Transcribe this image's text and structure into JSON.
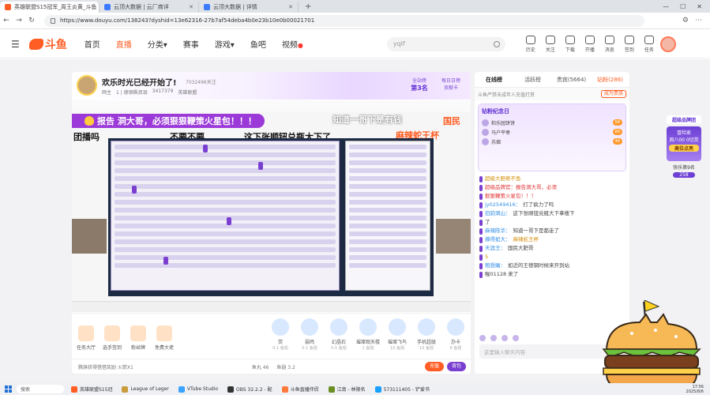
{
  "browser": {
    "tabs": [
      {
        "title": "英雄联盟S15冠军_周王炎黄_斗鱼",
        "active": true
      },
      {
        "title": "云顶大数据 | 云厂商详",
        "active": false
      },
      {
        "title": "云顶大数据 | 详情",
        "active": false
      }
    ],
    "url": "https://www.douyu.com/138243?dyshid=13e62316-27b7af54deba4b0e23b10e0b00021701"
  },
  "site": {
    "logo": "斗鱼",
    "nav": [
      {
        "label": "首页"
      },
      {
        "label": "直播"
      },
      {
        "label": "分类"
      },
      {
        "label": "赛事"
      },
      {
        "label": "游戏"
      },
      {
        "label": "鱼吧"
      },
      {
        "label": "视频"
      }
    ],
    "search_placeholder": "yqlf",
    "tools": [
      {
        "label": "历史"
      },
      {
        "label": "关注"
      },
      {
        "label": "下载"
      },
      {
        "label": "开播"
      },
      {
        "label": "消息"
      },
      {
        "label": "签到"
      },
      {
        "label": "任务"
      }
    ]
  },
  "room": {
    "title": "欢乐时光已经开始了!",
    "room_id": "7032496关注",
    "meta": [
      "网主",
      "1 | 德钢枫叔溺",
      "3417379",
      "英雄联盟"
    ],
    "rank_label": "全站榜",
    "rank_value": "第3名",
    "rank2_label": "每日日榜",
    "rank2_value": "贡献卡"
  },
  "video": {
    "banner": "报告 洞大哥，必须狠狠鞭策火星包！！！",
    "overlay_1": "团播吗",
    "overlay_2": "不要不要",
    "overlay_3": "这下张顺钮兑瓶大下了",
    "overlay_4": "知道一哥下是有钱",
    "overlay_5": "麻辣蛇王杯",
    "overlay_6": "国民"
  },
  "gifts_left": [
    {
      "label": "任务大厅"
    },
    {
      "label": "选手签到"
    },
    {
      "label": "粉丝牌"
    },
    {
      "label": "免费大佬"
    }
  ],
  "gifts_right": [
    {
      "label": "荧",
      "price": "0.1 鱼翅"
    },
    {
      "label": "弱鸡",
      "price": "0.1 鱼翅"
    },
    {
      "label": "幻晶石",
      "price": "0.5 鱼翅"
    },
    {
      "label": "璀璨观天楼",
      "price": "1 鱼翅"
    },
    {
      "label": "璀璨飞鸟",
      "price": "10 鱼翅"
    },
    {
      "label": "手机超级",
      "price": "10 鱼翅"
    },
    {
      "label": "办卡",
      "price": "6 鱼翅"
    }
  ],
  "bottom": {
    "notice": "腾旗获得借借奖励 火箭X1",
    "stats": "鱼丸 46",
    "fish": "鱼翅 3.2",
    "btn_charge": "充值",
    "btn_bag": "背包"
  },
  "chat": {
    "tabs": [
      {
        "label": "在线榜"
      },
      {
        "label": "活跃榜"
      },
      {
        "label": "贵宾(5664)"
      },
      {
        "label": "钻粉(286)"
      }
    ],
    "notice": "斗鱼严禁未成年人充值打赏",
    "notice_btn": "成为贵族",
    "fanbox_title": "钻粉纪念日",
    "fans": [
      {
        "name": "和乐园饼饼",
        "level": "54"
      },
      {
        "name": "马户平枣",
        "level": "60"
      },
      {
        "name": "苏烟",
        "level": "44"
      }
    ],
    "messages": [
      {
        "user": "",
        "text": "超级大胆奇不鱼",
        "cls": "gold"
      },
      {
        "user": "",
        "text": "超级品牌官：报告洞大哥，必须",
        "cls": "red"
      },
      {
        "user": "",
        "text": "狠狠鞭策火星包！！！",
        "cls": "red"
      },
      {
        "user": "jy02549416：",
        "text": "打了疯力了吗",
        "cls": ""
      },
      {
        "user": "旧韵洞山：",
        "text": "这下张顺钮兑瓶大下拿楼下",
        "cls": ""
      },
      {
        "user": "",
        "text": "了",
        "cls": ""
      },
      {
        "user": "麻辣陈华：",
        "text": "知道一哥下是都走了",
        "cls": ""
      },
      {
        "user": "撑得如大：",
        "text": "麻辣蛇王杯",
        "cls": "gold"
      },
      {
        "user": "天涯王：",
        "text": "国民大肥哥",
        "cls": ""
      },
      {
        "user": "",
        "text": "5",
        "cls": "gold"
      },
      {
        "user": "租想痛：",
        "text": "如近的王德钢时候来开到站",
        "cls": ""
      },
      {
        "user": "",
        "text": "喔01128 来了",
        "cls": ""
      }
    ],
    "input_placeholder": "这里输入聊天内容"
  },
  "side_widget": {
    "title": "超级品牌团",
    "box_title": "冒险家",
    "box_sub": "周八00 0切货",
    "box_btn": "高位点亮",
    "count_label": "快乐第9名",
    "count": "258"
  },
  "os": {
    "search": "搜索",
    "apps": [
      {
        "label": "英雄联盟S15冠"
      },
      {
        "label": "League of Leger"
      },
      {
        "label": "VTube Studio"
      },
      {
        "label": "OBS 32.2.2 - 配"
      },
      {
        "label": "斗鱼直播伴侣"
      },
      {
        "label": "江南 - 林陵名"
      },
      {
        "label": "573111405 - 铲爱书"
      }
    ],
    "time": "17:56",
    "date": "2025/8/6"
  }
}
